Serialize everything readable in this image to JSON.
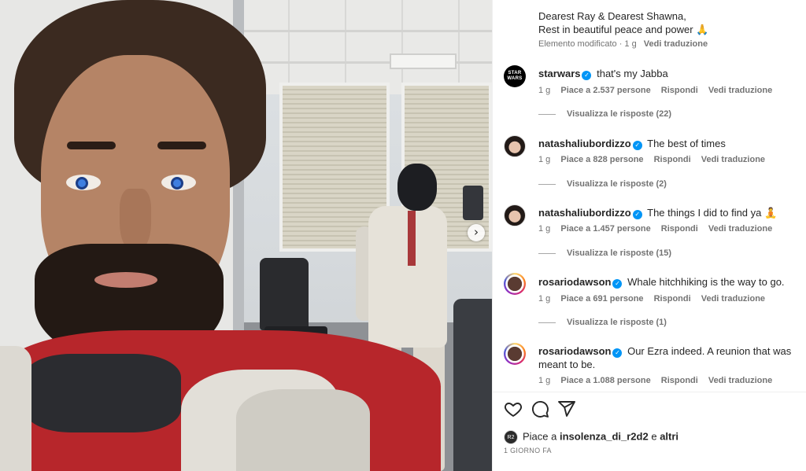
{
  "post": {
    "caption_line1": "Dearest Ray & Dearest Shawna,",
    "caption_line2": "Rest in beautiful peace and power 🙏",
    "caption_meta": "Elemento modificato · 1 g",
    "translate_label": "Vedi traduzione"
  },
  "comments": [
    {
      "user": "starwars",
      "avatar_text": "STAR WARS",
      "verified": true,
      "text": "that's my Jabba",
      "time": "1 g",
      "likes": "Piace a 2.537 persone",
      "reply_label": "Rispondi",
      "translate_label": "Vedi traduzione",
      "replies": "Visualizza le risposte (22)"
    },
    {
      "user": "natashaliubordizzo",
      "verified": true,
      "text": "The best of times",
      "time": "1 g",
      "likes": "Piace a 828 persone",
      "reply_label": "Rispondi",
      "translate_label": "Vedi traduzione",
      "replies": "Visualizza le risposte (2)"
    },
    {
      "user": "natashaliubordizzo",
      "verified": true,
      "text": "The things I did to find ya 🧘",
      "time": "1 g",
      "likes": "Piace a 1.457 persone",
      "reply_label": "Rispondi",
      "translate_label": "Vedi traduzione",
      "replies": "Visualizza le risposte (15)"
    },
    {
      "user": "rosariodawson",
      "verified": true,
      "text": "Whale hitchhiking is the way to go.",
      "time": "1 g",
      "likes": "Piace a 691 persone",
      "reply_label": "Rispondi",
      "translate_label": "Vedi traduzione",
      "replies": "Visualizza le risposte (1)"
    },
    {
      "user": "rosariodawson",
      "verified": true,
      "text": "Our Ezra indeed. A reunion that was meant to be.",
      "time": "1 g",
      "likes": "Piace a 1.088 persone",
      "reply_label": "Rispondi",
      "translate_label": "Vedi traduzione"
    }
  ],
  "actions": {
    "like_icon": "heart-icon",
    "comment_icon": "comment-bubble-icon",
    "share_icon": "paper-plane-icon"
  },
  "likes_row": {
    "prefix": "Piace a",
    "user": "insolenza_di_r2d2",
    "connector": "e",
    "others": "altri"
  },
  "timestamp": "1 GIORNO FA",
  "carousel": {
    "next_icon": "chevron-right-icon",
    "next_glyph": "›"
  },
  "colors": {
    "verified": "#0095f6",
    "muted": "#737373",
    "text": "#262626"
  }
}
